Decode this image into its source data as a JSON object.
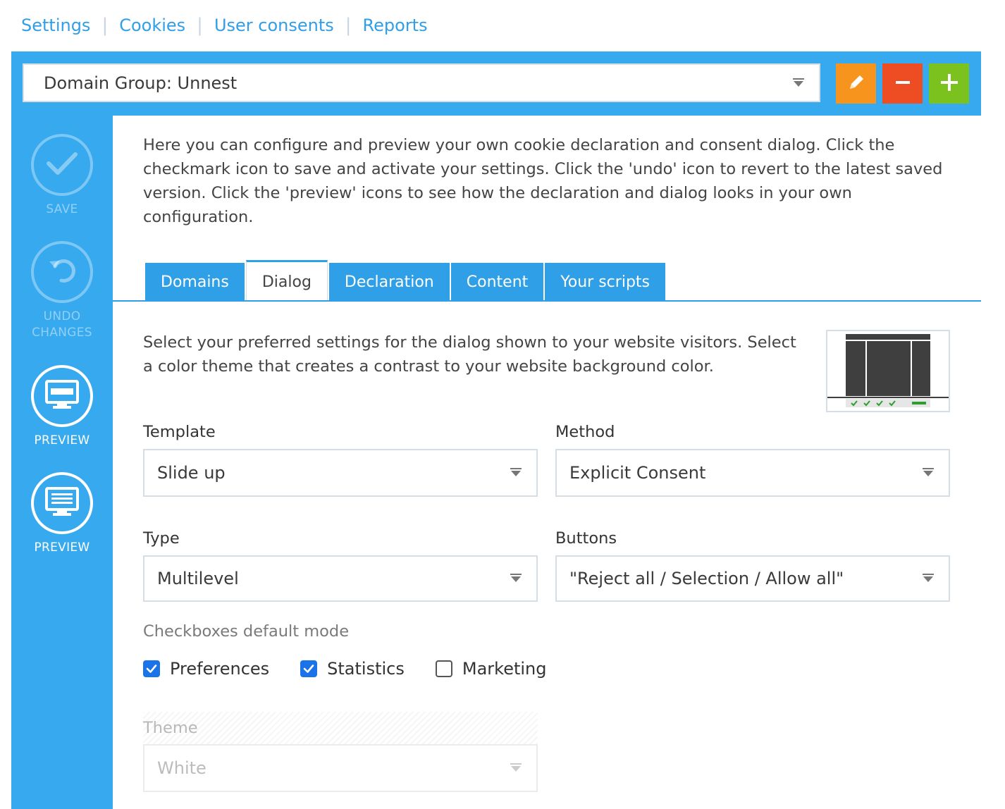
{
  "topnav": {
    "items": [
      "Settings",
      "Cookies",
      "User consents",
      "Reports"
    ]
  },
  "header": {
    "domain_group": "Domain Group: Unnest",
    "buttons": {
      "edit": "edit",
      "remove": "remove",
      "add": "add"
    }
  },
  "sidebar": {
    "save_label": "SAVE",
    "undo_label_1": "UNDO",
    "undo_label_2": "CHANGES",
    "preview1_label": "PREVIEW",
    "preview2_label": "PREVIEW"
  },
  "content": {
    "intro": "Here you can configure and preview your own cookie declaration and consent dialog. Click the checkmark icon to save and activate your settings. Click the 'undo' icon to revert to the latest saved version. Click the 'preview' icons to see how the declaration and dialog looks in your own configuration.",
    "tabs": [
      {
        "label": "Domains",
        "active": false
      },
      {
        "label": "Dialog",
        "active": true
      },
      {
        "label": "Declaration",
        "active": false
      },
      {
        "label": "Content",
        "active": false
      },
      {
        "label": "Your scripts",
        "active": false
      }
    ],
    "description": "Select your preferred settings for the dialog shown to your website visitors. Select a color theme that creates a contrast to your website background color.",
    "template": {
      "label": "Template",
      "value": "Slide up"
    },
    "method": {
      "label": "Method",
      "value": "Explicit Consent"
    },
    "type": {
      "label": "Type",
      "value": "Multilevel"
    },
    "buttons": {
      "label": "Buttons",
      "value": "\"Reject all / Selection / Allow all\""
    },
    "checkboxes": {
      "label": "Checkboxes default mode",
      "items": [
        {
          "label": "Preferences",
          "checked": true
        },
        {
          "label": "Statistics",
          "checked": true
        },
        {
          "label": "Marketing",
          "checked": false
        }
      ]
    },
    "theme": {
      "label": "Theme",
      "value": "White"
    }
  },
  "colors": {
    "accent_blue": "#37a9ee",
    "link_blue": "#2f9fe8",
    "edit_orange": "#f6941d",
    "remove_red": "#ee4d24",
    "add_green": "#7cc21e",
    "checkbox_blue": "#1a73e8"
  },
  "icons": [
    "caret-icon",
    "pencil-icon",
    "minus-icon",
    "plus-icon",
    "checkmark-icon",
    "undo-icon",
    "monitor-icon",
    "monitor-lines-icon"
  ]
}
